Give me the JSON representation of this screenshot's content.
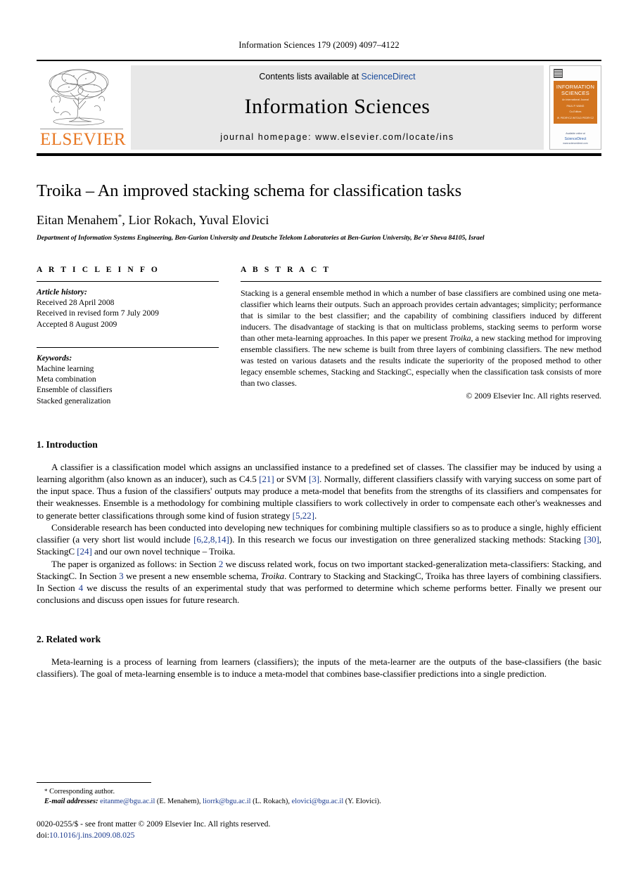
{
  "running_head": "Information Sciences 179 (2009) 4097–4122",
  "masthead": {
    "publisher_name": "ELSEVIER",
    "contents_prefix": "Contents lists available at ",
    "contents_link": "ScienceDirect",
    "journal_name": "Information Sciences",
    "homepage": "journal homepage: www.elsevier.com/locate/ins",
    "cover": {
      "line1": "INFORMATION",
      "line2": "SCIENCES",
      "line3": "An International Journal",
      "line4": "Editor-in-Chief",
      "line5": "PAUL P. WANG",
      "line6": "Co-Editors",
      "line7": "W. PEDRYCZ  WITOLD PEDRYCZ",
      "foot1": "Available online at",
      "foot2": "ScienceDirect",
      "foot3": "www.sciencedirect.com"
    },
    "accent_color": "#E87722",
    "link_color": "#1a4b9c",
    "cover_block_color": "#d2741f"
  },
  "article": {
    "title": "Troika – An improved stacking schema for classification tasks",
    "authors": "Eitan Menahem, Lior Rokach, Yuval Elovici",
    "corresponding_marker": "*",
    "affiliation": "Department of Information Systems Engineering, Ben-Gurion University and Deutsche Telekom Laboratories at Ben-Gurion University, Be'er Sheva 84105, Israel"
  },
  "article_info": {
    "heading": "A R T I C L E    I N F O",
    "history_label": "Article history:",
    "history": [
      "Received 28 April 2008",
      "Received in revised form 7 July 2009",
      "Accepted 8 August 2009"
    ],
    "keywords_label": "Keywords:",
    "keywords": [
      "Machine learning",
      "Meta combination",
      "Ensemble of classifiers",
      "Stacked generalization"
    ]
  },
  "abstract": {
    "heading": "A B S T R A C T",
    "p1_a": "Stacking is a general ensemble method in which a number of base classifiers are combined using one meta-classifier which learns their outputs. Such an approach provides certain advantages; simplicity; performance that is similar to the best classifier; and the capability of combining classifiers induced by different inducers. The disadvantage of stacking is that on multiclass problems, stacking seems to perform worse than other meta-learning approaches. In this paper we present ",
    "p1_italic": "Troika",
    "p1_b": ", a new stacking method for improving ensemble classifiers. The new scheme is built from three layers of combining classifiers. The new method was tested on various datasets and the results indicate the superiority of the proposed method to other legacy ensemble schemes, Stacking and StackingC, especially when the classification task consists of more than two classes.",
    "copyright": "© 2009 Elsevier Inc. All rights reserved."
  },
  "sections": {
    "intro_heading": "1. Introduction",
    "intro_p1_a": "A classifier is a classification model which assigns an unclassified instance to a predefined set of classes. The classifier may be induced by using a learning algorithm (also known as an inducer), such as C4.5 ",
    "intro_p1_ref1": "[21]",
    "intro_p1_b": " or SVM ",
    "intro_p1_ref2": "[3]",
    "intro_p1_c": ". Normally, different classifiers classify with varying success on some part of the input space. Thus a fusion of the classifiers' outputs may produce a meta-model that benefits from the strengths of its classifiers and compensates for their weaknesses. Ensemble is a methodology for combining multiple classifiers to work collectively in order to compensate each other's weaknesses and to generate better classifications through some kind of fusion strategy ",
    "intro_p1_ref3": "[5,22]",
    "intro_p1_d": ".",
    "intro_p2_a": "Considerable research has been conducted into developing new techniques for combining multiple classifiers so as to produce a single, highly efficient classifier (a very short list would include ",
    "intro_p2_ref1": "[6,2,8,14]",
    "intro_p2_b": "). In this research we focus our investigation on three generalized stacking methods: Stacking ",
    "intro_p2_ref2": "[30]",
    "intro_p2_c": ", StackingC ",
    "intro_p2_ref3": "[24]",
    "intro_p2_d": " and our own novel technique – Troika.",
    "intro_p3_a": "The paper is organized as follows: in Section ",
    "intro_p3_ref1": "2",
    "intro_p3_b": " we discuss related work, focus on two important stacked-generalization meta-classifiers: Stacking, and StackingC. In Section ",
    "intro_p3_ref2": "3",
    "intro_p3_c": " we present a new ensemble schema, ",
    "intro_p3_italic": "Troika",
    "intro_p3_d": ". Contrary to Stacking and StackingC, Troika has three layers of combining classifiers. In Section ",
    "intro_p3_ref3": "4",
    "intro_p3_e": " we discuss the results of an experimental study that was performed to determine which scheme performs better. Finally we present our conclusions and discuss open issues for future research.",
    "related_heading": "2. Related work",
    "related_p1": "Meta-learning is a process of learning from learners (classifiers); the inputs of the meta-learner are the outputs of the base-classifiers (the basic classifiers). The goal of meta-learning ensemble is to induce a meta-model that combines base-classifier predictions into a single prediction."
  },
  "footnotes": {
    "corresponding": "Corresponding author.",
    "email_label": "E-mail addresses:",
    "emails": [
      {
        "address": "eitanme@bgu.ac.il",
        "name": " (E. Menahem), "
      },
      {
        "address": "liorrk@bgu.ac.il",
        "name": " (L. Rokach), "
      },
      {
        "address": "elovici@bgu.ac.il",
        "name": " (Y. Elovici)."
      }
    ],
    "imprint": "0020-0255/$ - see front matter © 2009 Elsevier Inc. All rights reserved.",
    "doi_label": "doi:",
    "doi_value": "10.1016/j.ins.2009.08.025"
  }
}
